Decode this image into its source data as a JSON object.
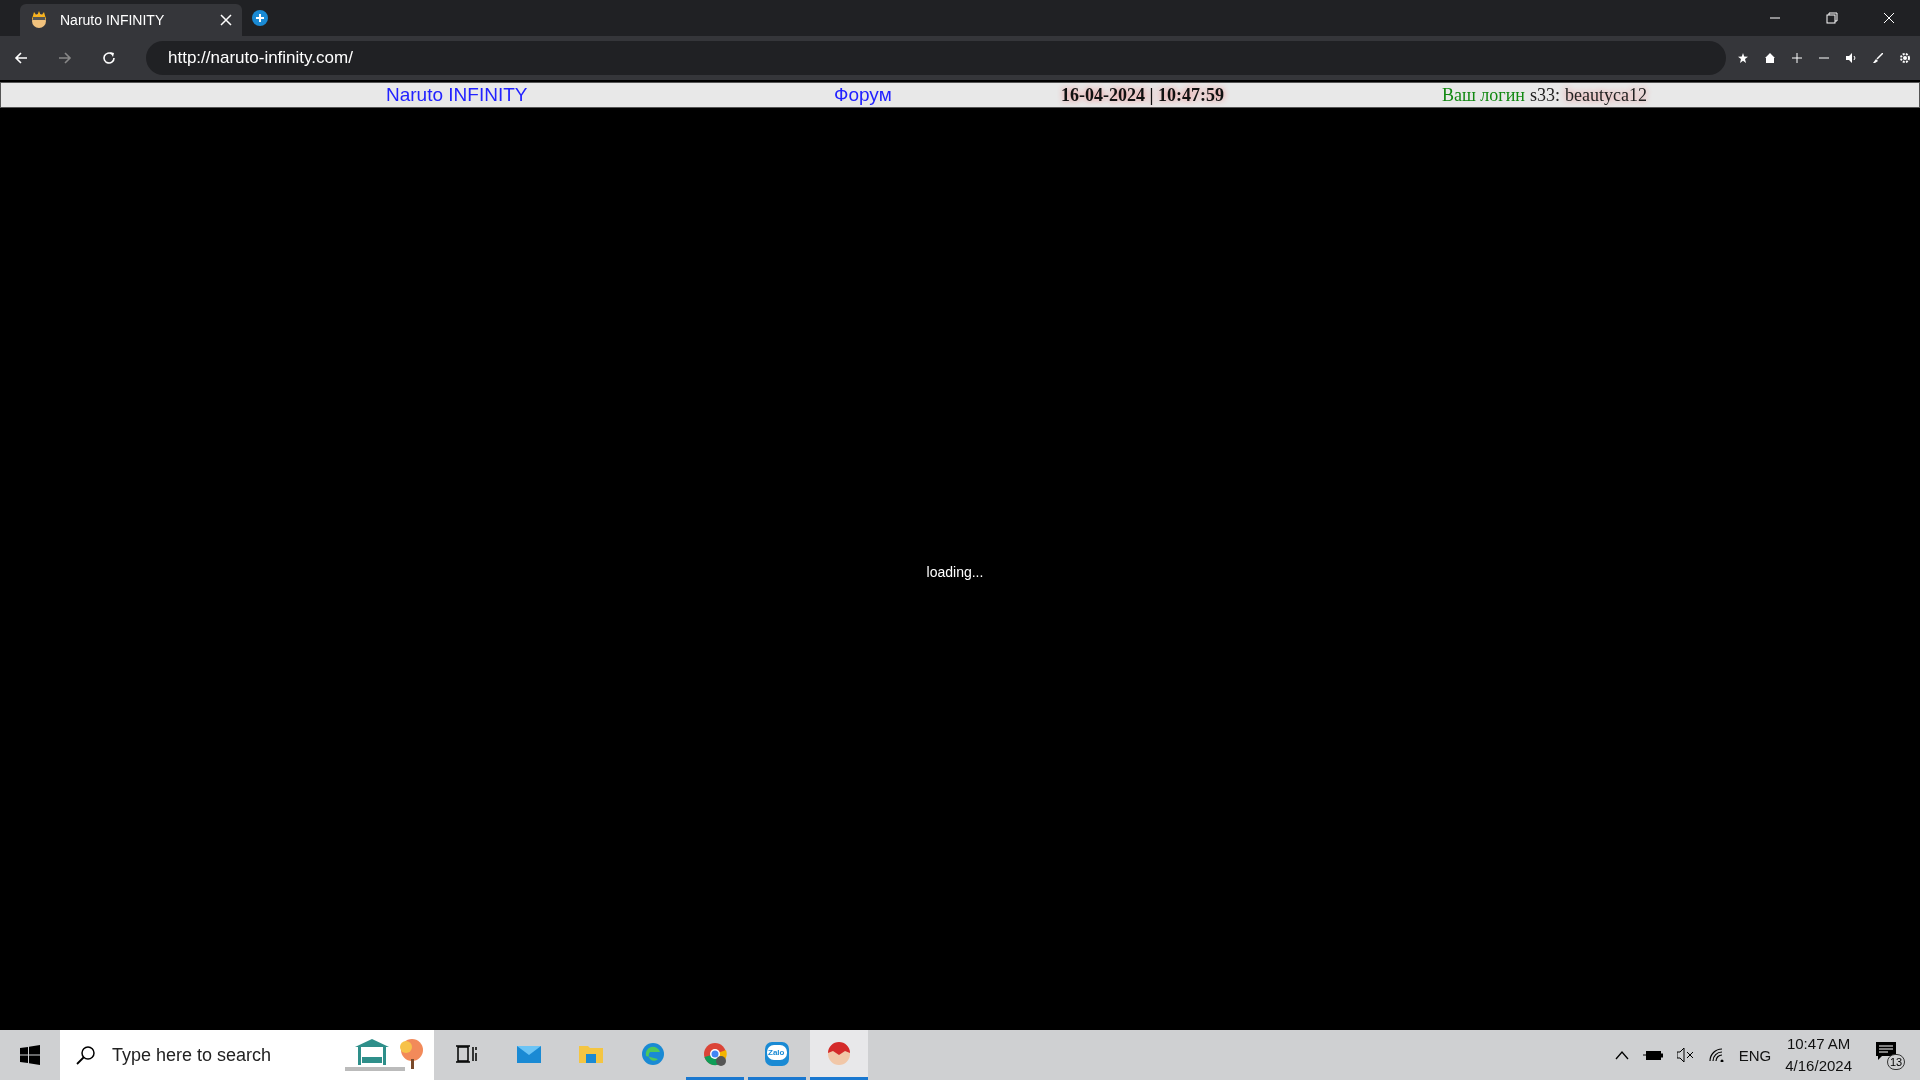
{
  "browser": {
    "tab": {
      "title": "Naruto INFINITY",
      "selected": true
    },
    "address": "http://naruto-infinity.com/"
  },
  "header": {
    "site_link": "Naruto INFINITY",
    "forum_link": "Форум",
    "datetime": "16-04-2024 | 10:47:59",
    "login": {
      "label": "Ваш логин",
      "server": "s33:",
      "name": "beautyca12"
    }
  },
  "content": {
    "status": "loading..."
  },
  "taskbar": {
    "search": {
      "placeholder": "Type here to search"
    },
    "apps": [
      {
        "kind": "taskview",
        "running": false,
        "active": false
      },
      {
        "kind": "mail",
        "running": false,
        "active": false
      },
      {
        "kind": "files",
        "running": false,
        "active": false
      },
      {
        "kind": "edge",
        "running": false,
        "active": false
      },
      {
        "kind": "chrome",
        "running": true,
        "active": false
      },
      {
        "kind": "zalo",
        "running": true,
        "active": false,
        "label": "Zalo"
      },
      {
        "kind": "game",
        "running": true,
        "active": true
      }
    ],
    "language": "ENG",
    "time": "10:47 AM",
    "date": "4/16/2024",
    "notifications": "13"
  }
}
